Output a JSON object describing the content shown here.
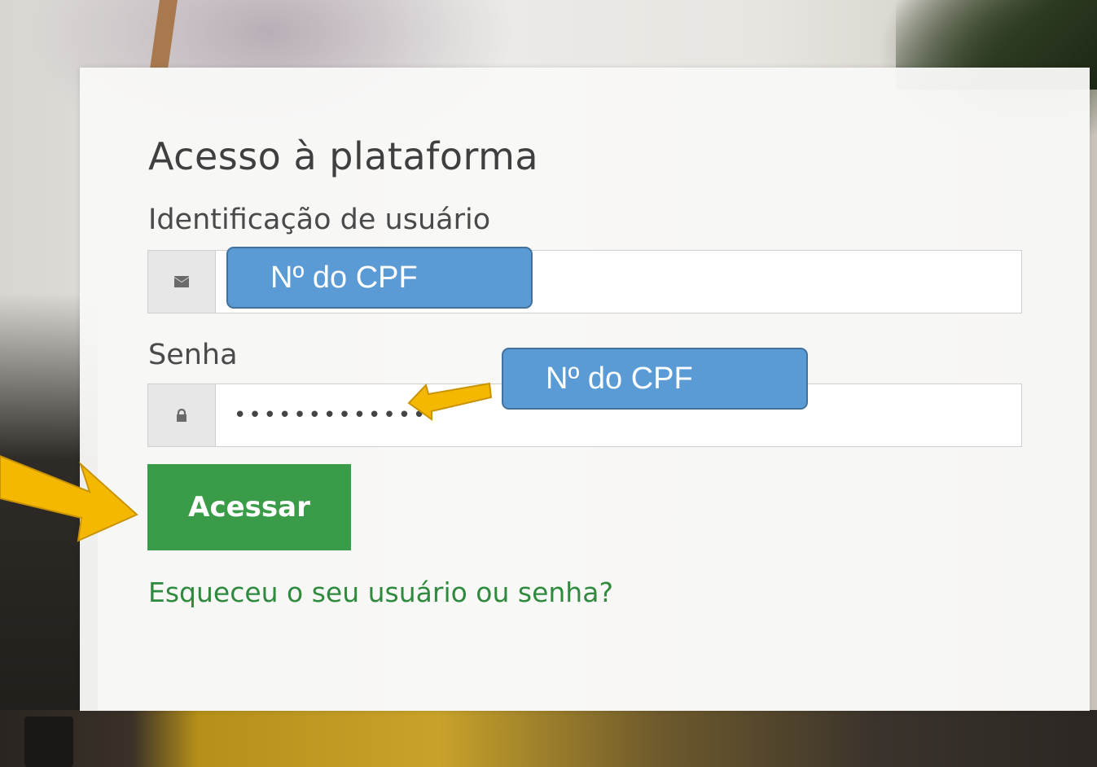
{
  "login": {
    "title": "Acesso à plataforma",
    "username_label": "Identificação de usuário",
    "username_value": "",
    "password_label": "Senha",
    "password_value": "•••••••••••••",
    "submit_label": "Acessar",
    "forgot_link": "Esqueceu o seu usuário ou senha?"
  },
  "annotations": {
    "username_callout": "Nº do CPF",
    "password_callout": "Nº do CPF"
  },
  "icons": {
    "username": "envelope-icon",
    "password": "lock-icon"
  },
  "colors": {
    "accent": "#3a9b48",
    "link": "#2f8a3e",
    "callout": "#5b9bd5",
    "arrow": "#f5b800"
  }
}
